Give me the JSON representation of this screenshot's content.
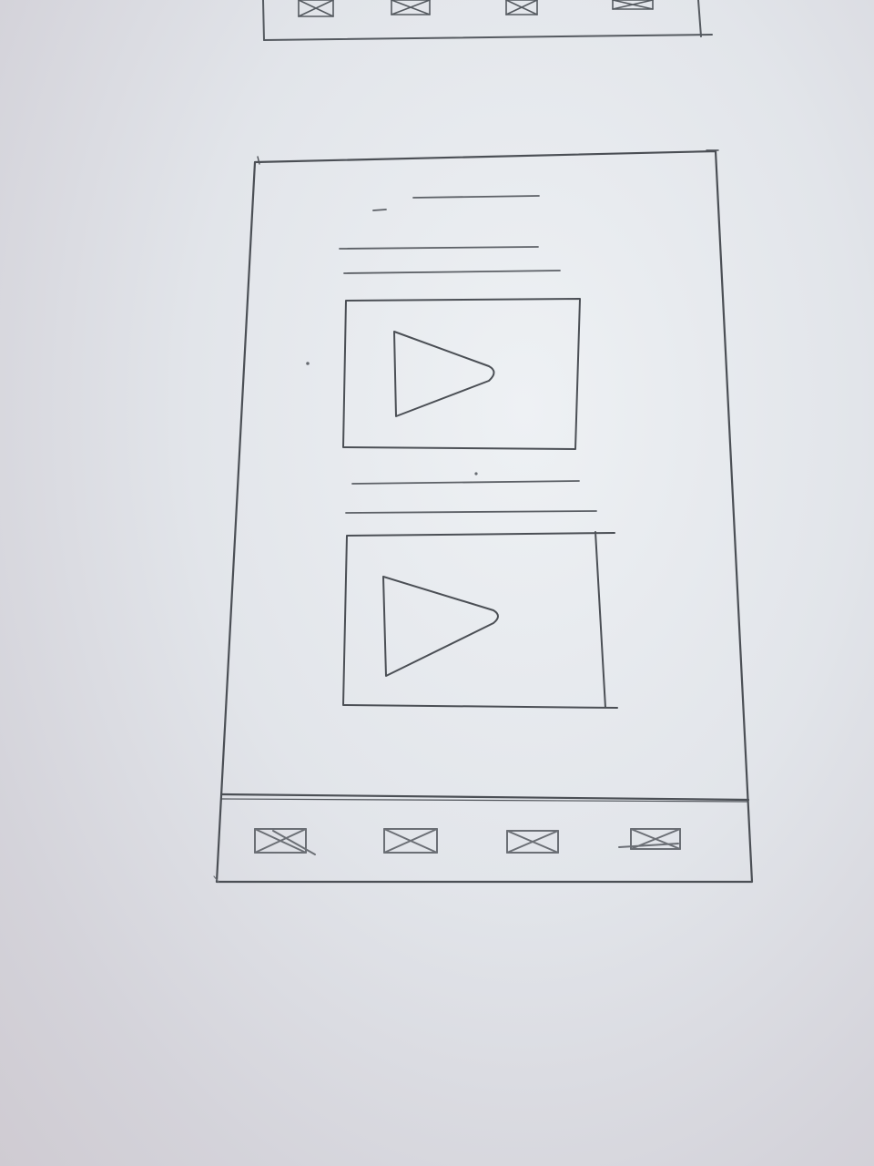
{
  "colors": {
    "paper": "#e4e7eb",
    "pencil": "#4b4f55",
    "pencil_light": "#7b7f86"
  },
  "top_partial_wireframe": {
    "nav_icons": [
      "placeholder-image-icon",
      "placeholder-image-icon",
      "placeholder-image-icon",
      "placeholder-image-icon"
    ]
  },
  "main_wireframe": {
    "text_line_groups": 2,
    "video_placeholders": [
      {
        "icon": "play-icon"
      },
      {
        "icon": "play-icon"
      }
    ],
    "bottom_nav_icons": [
      "placeholder-image-icon",
      "placeholder-image-icon",
      "placeholder-image-icon",
      "placeholder-image-icon"
    ]
  }
}
